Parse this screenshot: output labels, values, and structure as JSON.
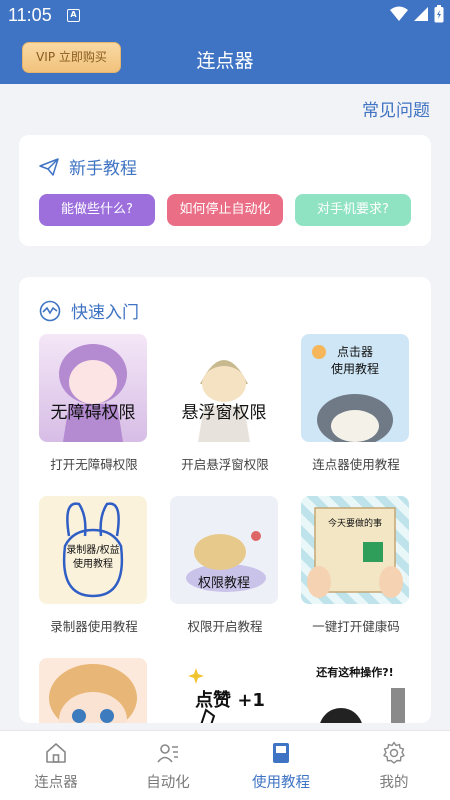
{
  "status_bar": {
    "time": "11:05",
    "notification_icon_letter": "A"
  },
  "app_bar": {
    "vip_button": "VIP 立即购买",
    "title": "连点器"
  },
  "faq_link": "常见问题",
  "beginner_section": {
    "title": "新手教程",
    "buttons": [
      "能做些什么?",
      "如何停止自动化",
      "对手机要求?"
    ]
  },
  "quick_section": {
    "title": "快速入门",
    "items": [
      {
        "caption": "打开无障碍权限",
        "image_text": "无障碍权限"
      },
      {
        "caption": "开启悬浮窗权限",
        "image_text": "悬浮窗权限"
      },
      {
        "caption": "连点器使用教程",
        "image_text": "点击器\n使用教程"
      },
      {
        "caption": "录制器使用教程",
        "image_text": "录制器/权益\n使用教程"
      },
      {
        "caption": "权限开启教程",
        "image_text": "权限教程"
      },
      {
        "caption": "一键打开健康码",
        "image_text": "今天要做的事"
      },
      {
        "caption": "",
        "image_text": ""
      },
      {
        "caption": "",
        "image_text": "点赞 +1"
      },
      {
        "caption": "",
        "image_text": "还有这种操作?!"
      }
    ]
  },
  "tab_bar": {
    "tabs": [
      {
        "label": "连点器",
        "icon": "home-icon"
      },
      {
        "label": "自动化",
        "icon": "user-list-icon"
      },
      {
        "label": "使用教程",
        "icon": "book-icon"
      },
      {
        "label": "我的",
        "icon": "gear-icon"
      }
    ],
    "active_index": 2
  },
  "colors": {
    "primary": "#3f73c3",
    "vip_gold": "#f1c27c",
    "pill_purple": "#9c6fdc",
    "pill_pink": "#ea6f86",
    "pill_green": "#8fe3c2"
  }
}
